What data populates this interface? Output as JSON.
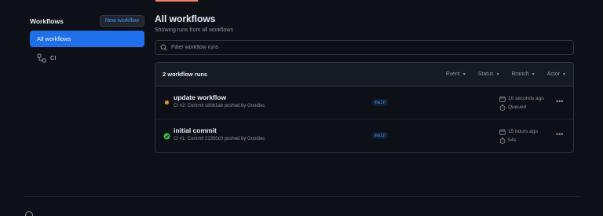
{
  "sidebar": {
    "title": "Workflows",
    "new_workflow_label": "New workflow",
    "items": [
      {
        "label": "All workflows"
      },
      {
        "label": "CI"
      }
    ]
  },
  "main": {
    "title": "All workflows",
    "subtitle": "Showing runs from all workflows",
    "filter_placeholder": "Filter workflow runs",
    "runs_count": "2 workflow runs",
    "filters": [
      "Event",
      "Status",
      "Branch",
      "Actor"
    ]
  },
  "runs": [
    {
      "title": "update workflow",
      "meta": "CI #2: Commit c80b1ab pushed by Goodiec",
      "branch": "main",
      "time": "10 seconds ago",
      "duration": "Queued",
      "status": "queued"
    },
    {
      "title": "initial commit",
      "meta": "CI #1: Commit 21350c0 pushed by Goodiec",
      "branch": "main",
      "time": "15 hours ago",
      "duration": "54s",
      "status": "success"
    }
  ],
  "colors": {
    "accent": "#1f6feb",
    "link": "#4493f8",
    "queued": "#d29922",
    "success": "#3fb950",
    "background": "#0d1117"
  },
  "icons": {
    "workflow": "workflow-icon",
    "search": "search-icon",
    "calendar": "calendar-icon",
    "stopwatch": "stopwatch-icon",
    "kebab": "kebab-menu-icon"
  }
}
